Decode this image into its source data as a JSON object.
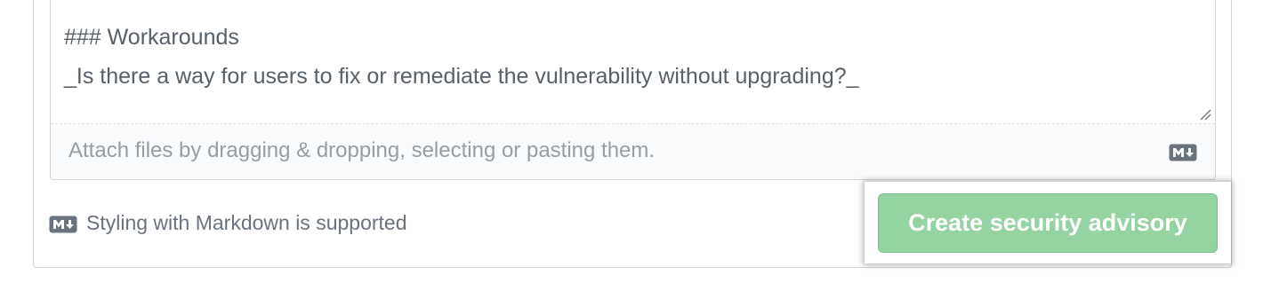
{
  "editor": {
    "lines": [
      "### Workarounds",
      "_Is there a way for users to fix or remediate the vulnerability without upgrading?_"
    ],
    "attach_hint": "Attach files by dragging & dropping, selecting or pasting them."
  },
  "footer": {
    "markdown_hint": "Styling with Markdown is supported",
    "submit_label": "Create security advisory"
  },
  "icons": {
    "markdown": "markdown-icon",
    "resize": "resize-handle-icon"
  },
  "colors": {
    "button_bg": "#94d3a2",
    "button_text": "#ffffff",
    "body_text": "#586069",
    "muted_text": "#959da5"
  }
}
